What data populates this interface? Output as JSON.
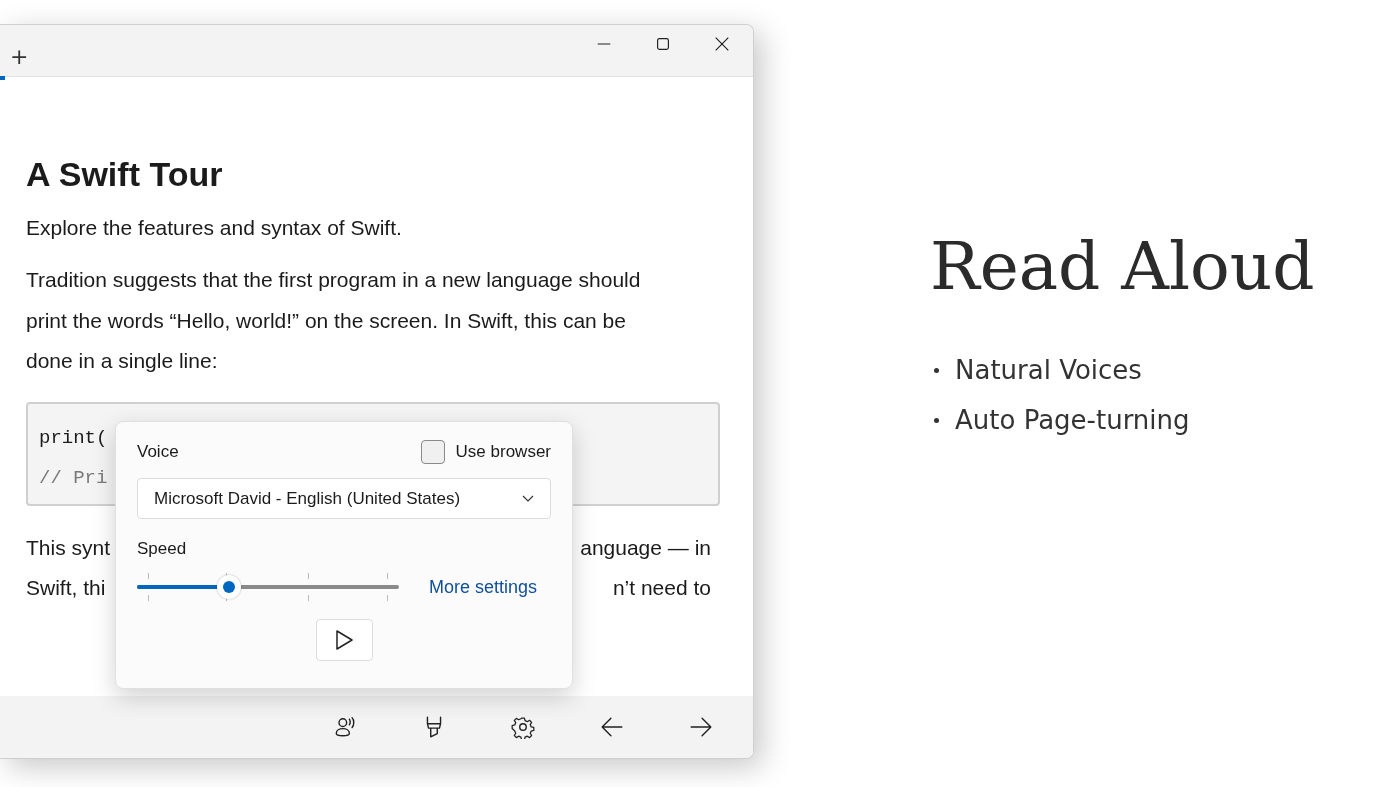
{
  "tab_strip": {
    "add_tab": "+"
  },
  "article": {
    "title": "A Swift Tour",
    "subtitle": "Explore the features and syntax of Swift.",
    "paragraph": "Tradition suggests that the first program in a new language should print the words “Hello, world!” on the screen. In Swift, this can be done in a single line:",
    "code_lines": [
      {
        "kind": "code",
        "text": "print("
      },
      {
        "kind": "comment",
        "text": "// Pri"
      }
    ],
    "covered_lines": [
      {
        "left": "This synt",
        "right": "anguage — in"
      },
      {
        "left": "Swift, thi",
        "right": "n’t need to"
      }
    ]
  },
  "read_aloud_panel": {
    "voice_label": "Voice",
    "use_browser": {
      "label": "Use browser",
      "checked": false
    },
    "voice": "Microsoft David - English (United States)",
    "speed_label": "Speed",
    "speed": {
      "level": 0.35
    },
    "more_settings": "More settings"
  },
  "toolbar": [
    {
      "kind": "read-aloud"
    },
    {
      "kind": "highlighter"
    },
    {
      "kind": "settings"
    },
    {
      "kind": "back"
    },
    {
      "kind": "forward"
    }
  ],
  "promo": {
    "title": "Read Aloud",
    "bullets": [
      "Natural Voices",
      "Auto Page-turning"
    ]
  }
}
